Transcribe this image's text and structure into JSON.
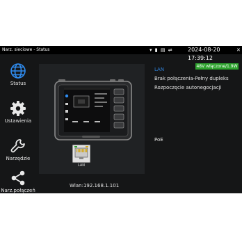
{
  "statusbar": {
    "title": "Narz. sieciowe - Status",
    "icons": [
      "wifi-icon",
      "battery-icon",
      "sd-card-icon",
      "usb-icon"
    ],
    "clock": "2024-08-20 17:39:12",
    "close_label": "✕"
  },
  "sidebar": {
    "items": [
      {
        "label": "Status",
        "icon": "globe-icon"
      },
      {
        "label": "Ustawienia",
        "icon": "gear-icon"
      },
      {
        "label": "Narzędzie",
        "icon": "wrench-icon"
      },
      {
        "label": "Narz.połączeń",
        "icon": "share-icon"
      }
    ]
  },
  "main": {
    "lan_port_label": "LAN",
    "wlan": "Wlan:192.168.1.101"
  },
  "info": {
    "badge": "48V włączone/1.9W",
    "badge_color": "#2ea32e",
    "lan_title": "LAN",
    "lan_title_color": "#2f7fd6",
    "connection": "Brak połączenia-Pełny dupleks",
    "negotiation": "Rozpoczęcie autonegocjacji",
    "poe": "PoE"
  }
}
